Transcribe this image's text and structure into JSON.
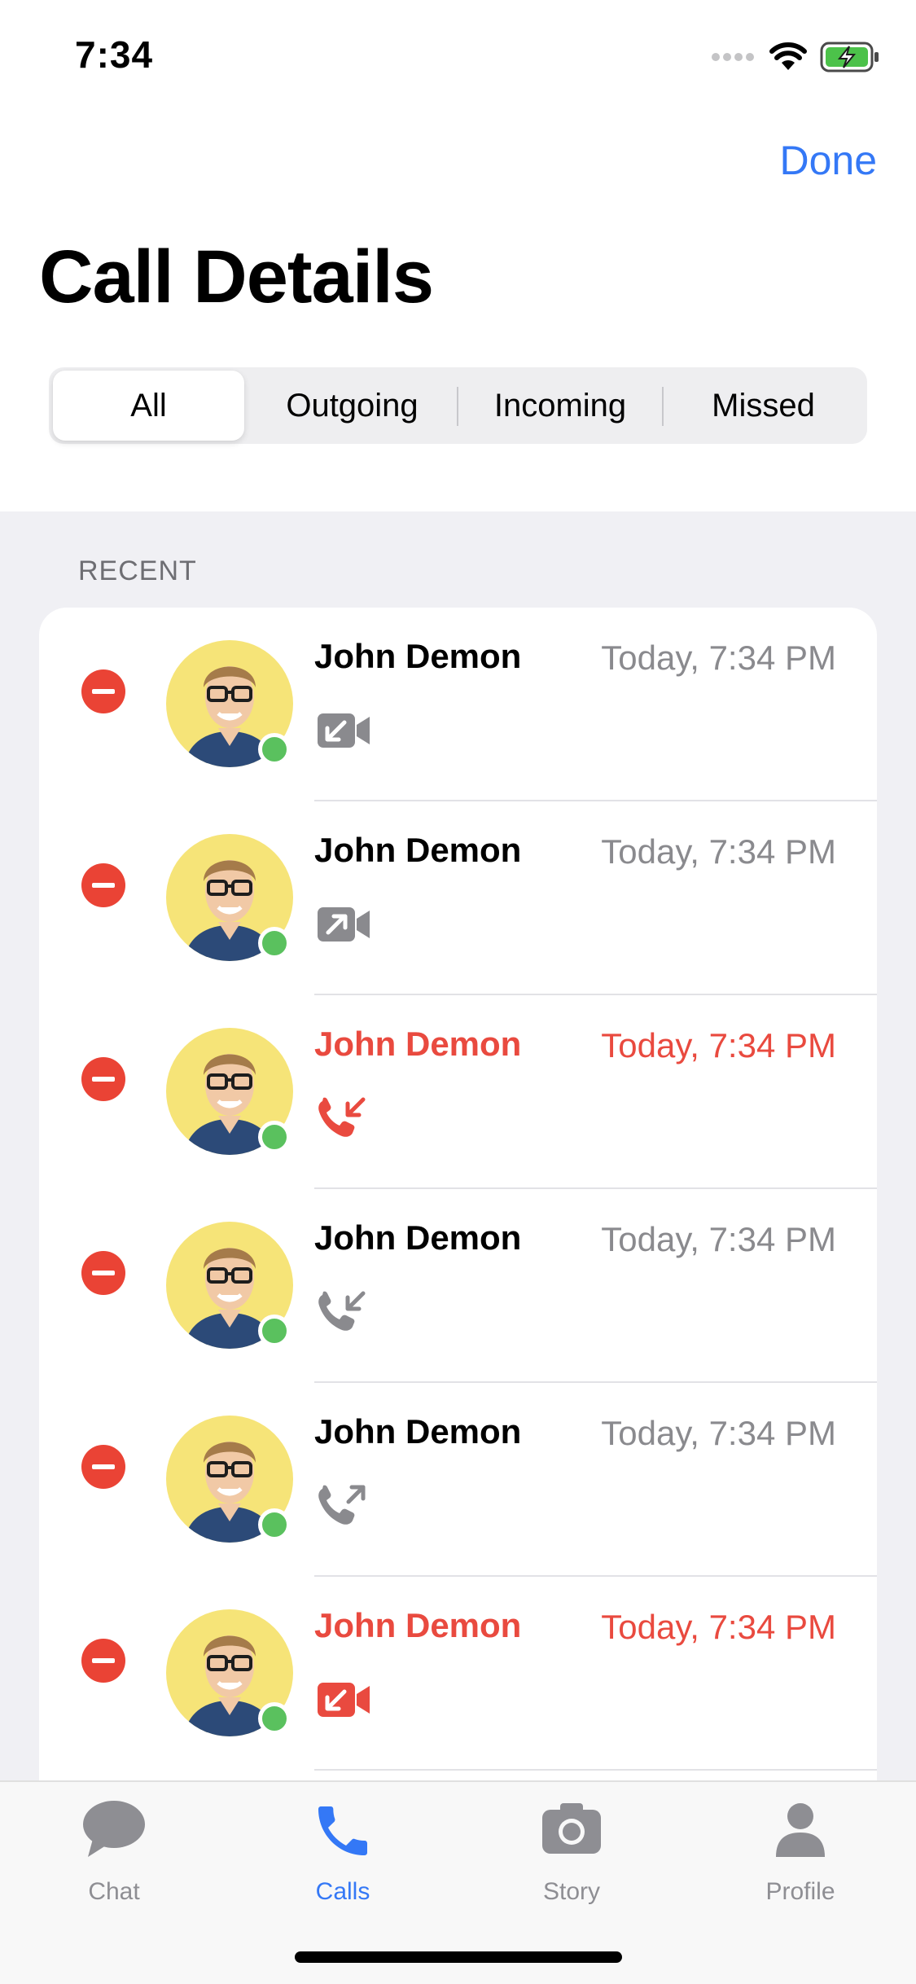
{
  "status_bar": {
    "time": "7:34",
    "icons": [
      "signal-icon",
      "wifi-icon",
      "battery-charging-icon"
    ]
  },
  "header": {
    "done_label": "Done",
    "title": "Call Details"
  },
  "segments": [
    {
      "label": "All",
      "selected": true
    },
    {
      "label": "Outgoing",
      "selected": false
    },
    {
      "label": "Incoming",
      "selected": false
    },
    {
      "label": "Missed",
      "selected": false
    }
  ],
  "section_header": "RECENT",
  "calls": [
    {
      "name": "John Demon",
      "time": "Today, 7:34 PM",
      "call_type": "video-incoming-icon",
      "missed": false,
      "online": true
    },
    {
      "name": "John Demon",
      "time": "Today, 7:34 PM",
      "call_type": "video-outgoing-icon",
      "missed": false,
      "online": true
    },
    {
      "name": "John Demon",
      "time": "Today, 7:34 PM",
      "call_type": "phone-incoming-icon",
      "missed": true,
      "online": true
    },
    {
      "name": "John Demon",
      "time": "Today, 7:34 PM",
      "call_type": "phone-incoming-icon",
      "missed": false,
      "online": true
    },
    {
      "name": "John Demon",
      "time": "Today, 7:34 PM",
      "call_type": "phone-outgoing-icon",
      "missed": false,
      "online": true
    },
    {
      "name": "John Demon",
      "time": "Today, 7:34 PM",
      "call_type": "video-incoming-icon",
      "missed": true,
      "online": true
    }
  ],
  "tabbar": {
    "items": [
      {
        "label": "Chat",
        "icon": "chat-bubble-icon",
        "active": false
      },
      {
        "label": "Calls",
        "icon": "phone-icon",
        "active": true
      },
      {
        "label": "Story",
        "icon": "camera-icon",
        "active": false
      },
      {
        "label": "Profile",
        "icon": "person-icon",
        "active": false
      }
    ]
  },
  "colors": {
    "accent": "#3478f6",
    "missed": "#e94a3f",
    "delete": "#ea4335",
    "online": "#5ac15e",
    "avatar_bg": "#f6e478",
    "icon_gray": "#8a8a8e"
  }
}
